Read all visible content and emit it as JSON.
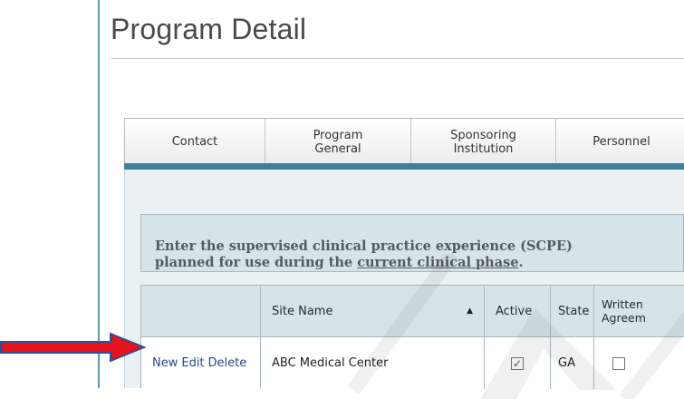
{
  "page": {
    "title": "Program Detail"
  },
  "tabs": [
    {
      "label": "Contact"
    },
    {
      "label": "Program\nGeneral"
    },
    {
      "label": "Sponsoring\nInstitution"
    },
    {
      "label": "Personnel"
    }
  ],
  "notice": {
    "line1": "Enter the supervised clinical practice experience (SCPE)",
    "line2_prefix": "planned for use during the ",
    "line2_link": "current clinical phase",
    "line2_suffix": "."
  },
  "table": {
    "columns": [
      {
        "label": ""
      },
      {
        "label": "Site Name",
        "sort_icon": "▲"
      },
      {
        "label": "Active"
      },
      {
        "label": "State"
      },
      {
        "label": "Written\nAgreem"
      }
    ],
    "rows": [
      {
        "actions": [
          "New",
          "Edit",
          "Delete"
        ],
        "site_name": "ABC Medical Center",
        "active": true,
        "state": "GA",
        "written_agreement": false
      }
    ]
  },
  "icons": {
    "annotation_arrow": "right-arrow-icon",
    "checkbox_checked": "checkmark-icon"
  },
  "colors": {
    "arrow_fill": "#e5131b",
    "arrow_stroke": "#2f4e9a",
    "link": "#26488c",
    "tab_underline": "#3f7f95",
    "header_bg": "#d6e4ea"
  }
}
